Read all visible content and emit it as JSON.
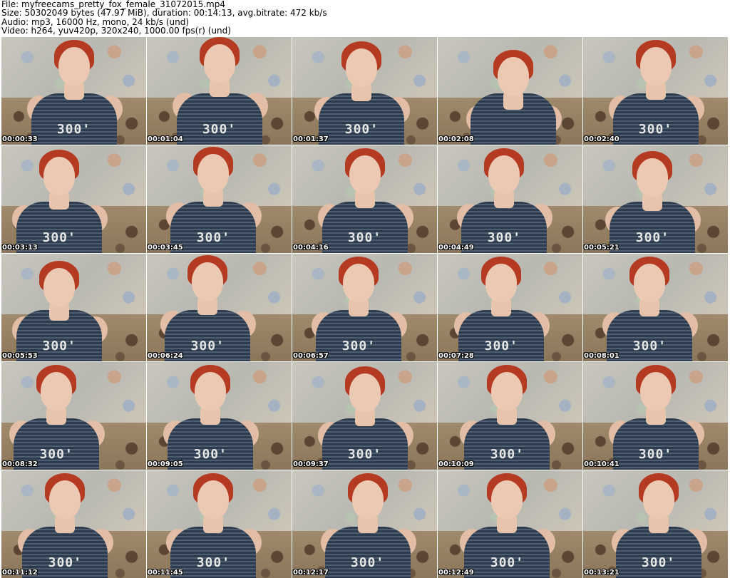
{
  "header": {
    "file_line": "File: myfreecams_pretty_fox_female_31072015.mp4",
    "size_line": "Size: 50302049 bytes (47.97 MiB), duration: 00:14:13, avg.bitrate: 472 kb/s",
    "audio_line": "Audio: mp3, 16000 Hz, mono, 24 kb/s (und)",
    "video_line": "Video: h264, yuv420p, 320x240, 1000.00 fps(r) (und)"
  },
  "thumbnails": [
    {
      "timestamp": "00:00:33",
      "shirt_text": "300'"
    },
    {
      "timestamp": "00:01:04",
      "shirt_text": "300'"
    },
    {
      "timestamp": "00:01:37",
      "shirt_text": "300'"
    },
    {
      "timestamp": "00:02:08",
      "shirt_text": ""
    },
    {
      "timestamp": "00:02:40",
      "shirt_text": "300'"
    },
    {
      "timestamp": "00:03:13",
      "shirt_text": "300'"
    },
    {
      "timestamp": "00:03:45",
      "shirt_text": "300'"
    },
    {
      "timestamp": "00:04:16",
      "shirt_text": "300'"
    },
    {
      "timestamp": "00:04:49",
      "shirt_text": "300'"
    },
    {
      "timestamp": "00:05:21",
      "shirt_text": "300'"
    },
    {
      "timestamp": "00:05:53",
      "shirt_text": "300'"
    },
    {
      "timestamp": "00:06:24",
      "shirt_text": "300'"
    },
    {
      "timestamp": "00:06:57",
      "shirt_text": "300'"
    },
    {
      "timestamp": "00:07:28",
      "shirt_text": "300'"
    },
    {
      "timestamp": "00:08:01",
      "shirt_text": "300'"
    },
    {
      "timestamp": "00:08:32",
      "shirt_text": "300'"
    },
    {
      "timestamp": "00:09:05",
      "shirt_text": "300'"
    },
    {
      "timestamp": "00:09:37",
      "shirt_text": "300'"
    },
    {
      "timestamp": "00:10:09",
      "shirt_text": "300'"
    },
    {
      "timestamp": "00:10:41",
      "shirt_text": "300'"
    },
    {
      "timestamp": "00:11:12",
      "shirt_text": "300'"
    },
    {
      "timestamp": "00:11:45",
      "shirt_text": "300'"
    },
    {
      "timestamp": "00:12:17",
      "shirt_text": "300'"
    },
    {
      "timestamp": "00:12:49",
      "shirt_text": "300'"
    },
    {
      "timestamp": "00:13:21",
      "shirt_text": "300'"
    }
  ]
}
